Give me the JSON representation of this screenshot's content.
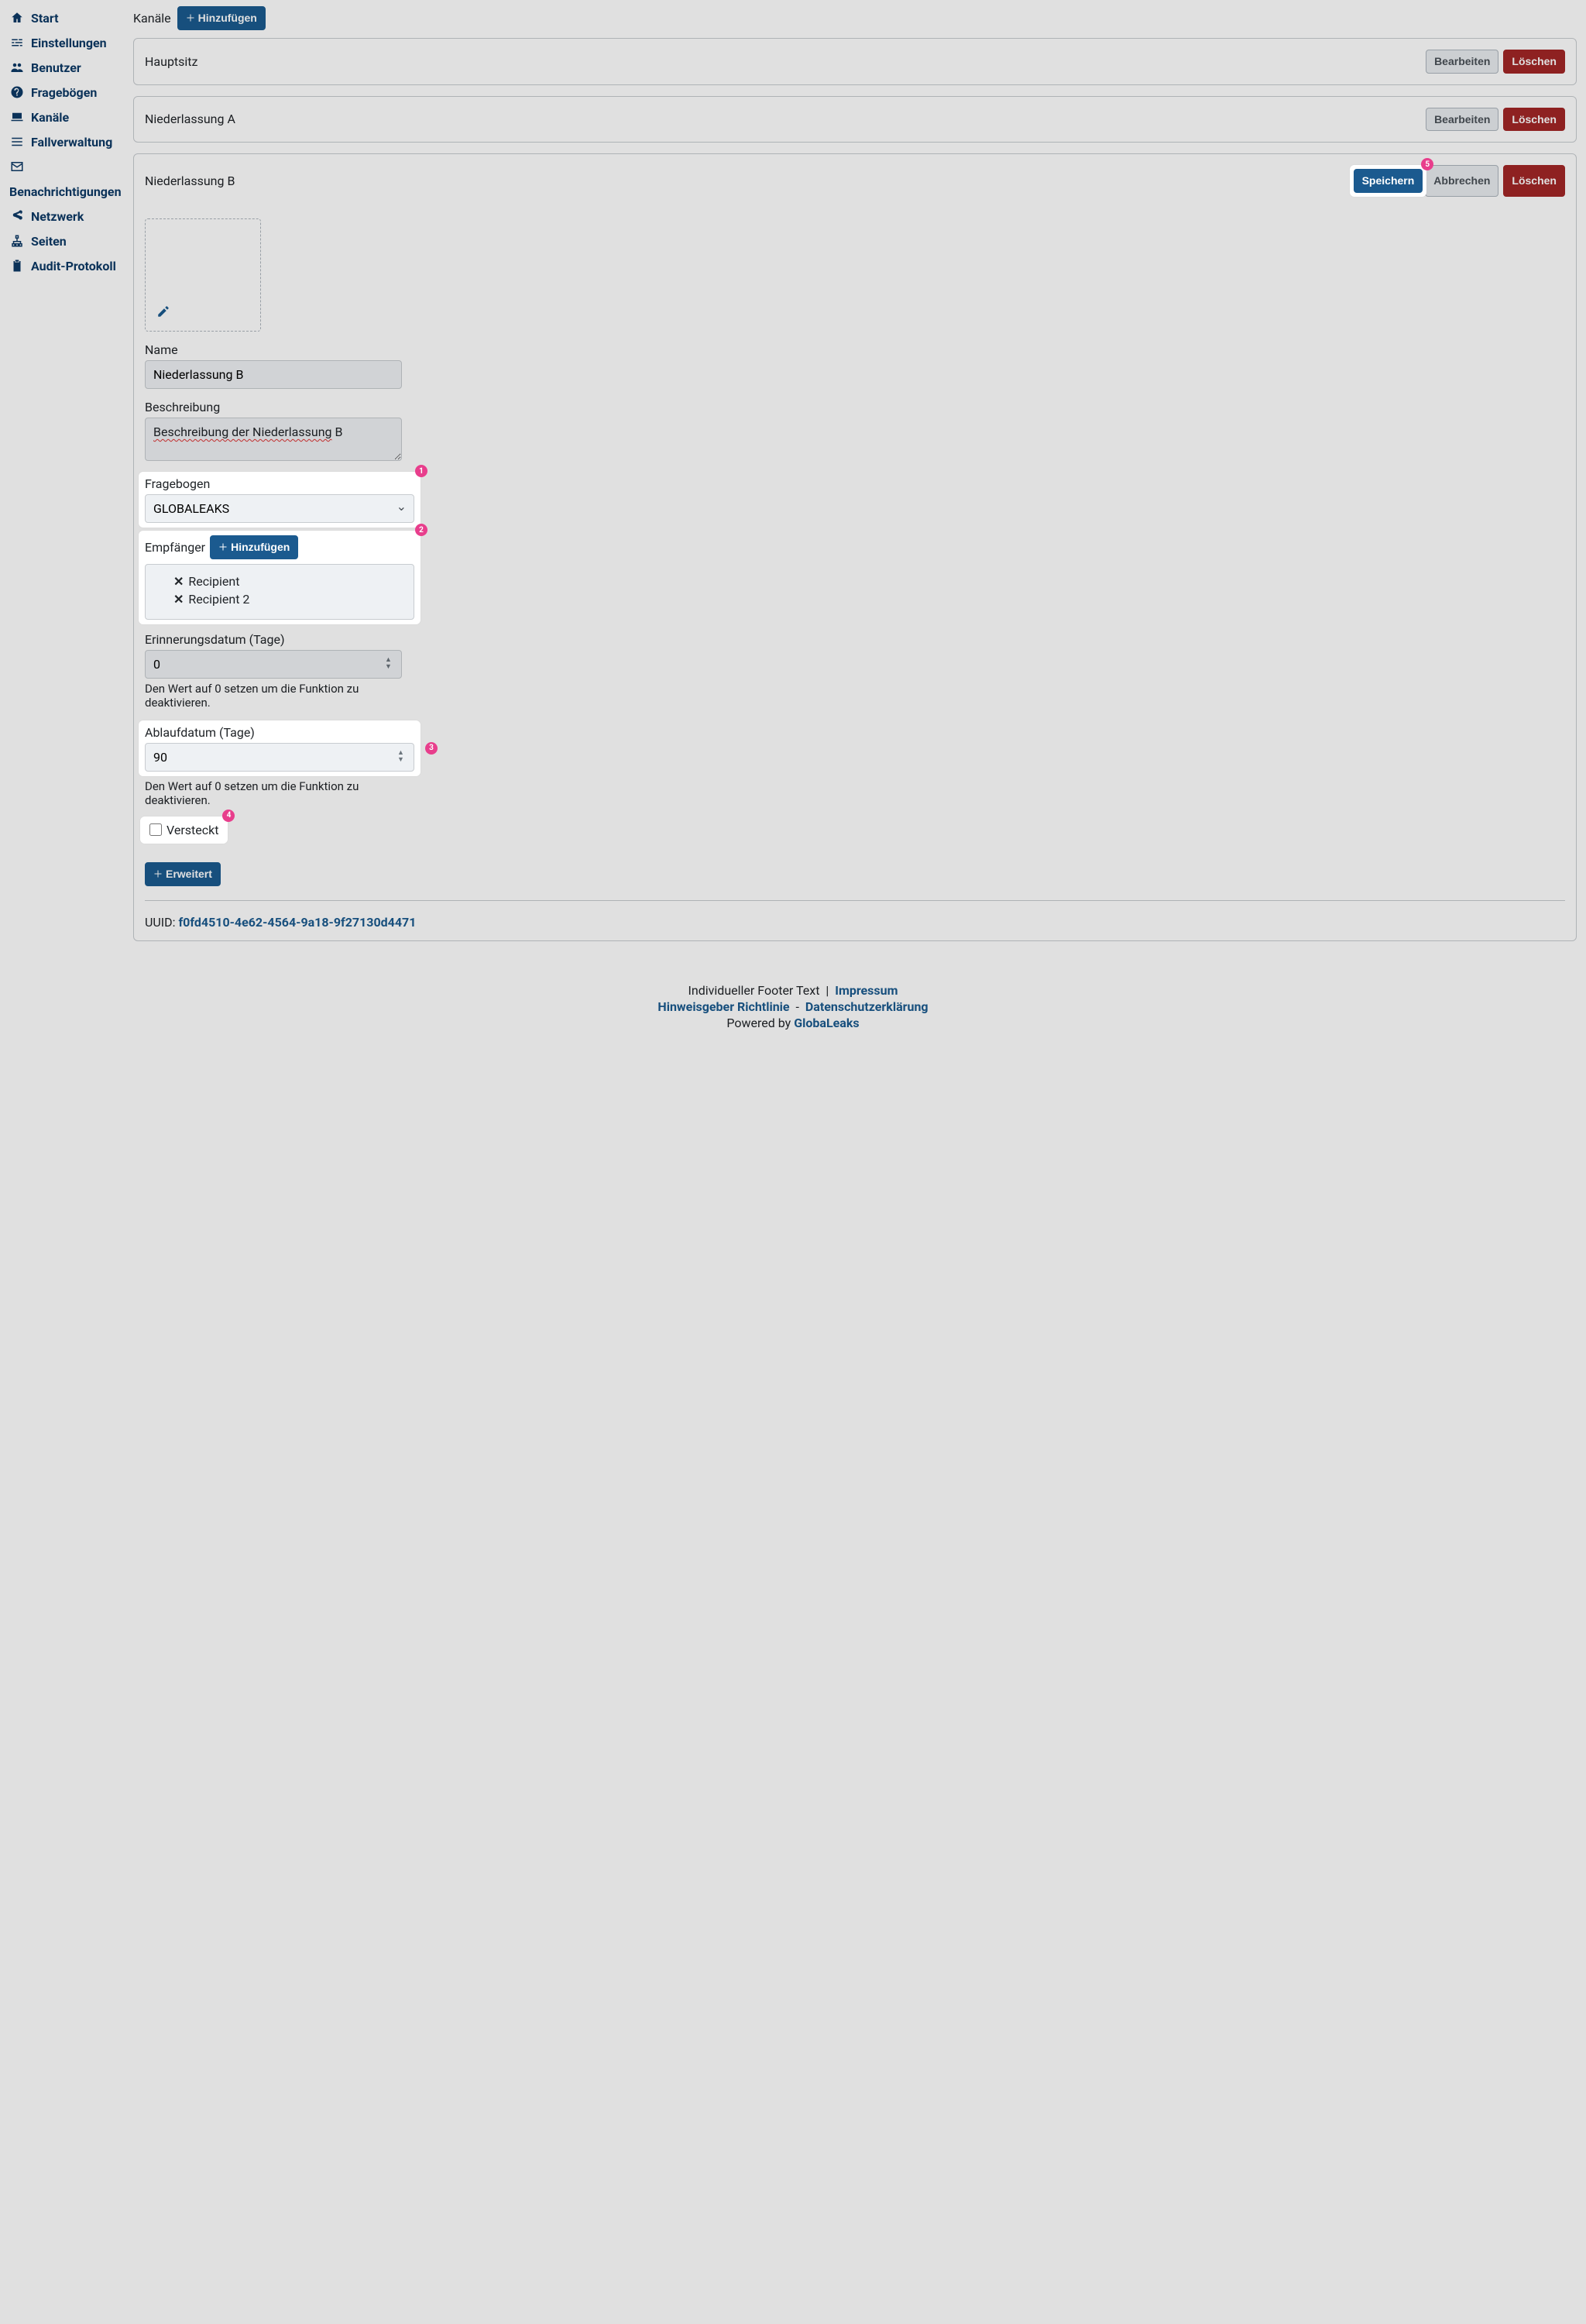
{
  "sidebar": {
    "items": [
      {
        "label": "Start",
        "icon": "home"
      },
      {
        "label": "Einstellungen",
        "icon": "sliders"
      },
      {
        "label": "Benutzer",
        "icon": "users"
      },
      {
        "label": "Fragebögen",
        "icon": "question"
      },
      {
        "label": "Kanäle",
        "icon": "laptop"
      },
      {
        "label": "Fallverwaltung",
        "icon": "list"
      },
      {
        "label": "Benachrichtigungen",
        "icon": "envelope"
      },
      {
        "label": "Netzwerk",
        "icon": "share"
      },
      {
        "label": "Seiten",
        "icon": "sitemap"
      },
      {
        "label": "Audit-Protokoll",
        "icon": "clipboard"
      }
    ]
  },
  "page": {
    "title": "Kanäle",
    "add_label": "Hinzufügen"
  },
  "channels": [
    {
      "title": "Hauptsitz",
      "edit": "Bearbeiten",
      "del": "Löschen"
    },
    {
      "title": "Niederlassung A",
      "edit": "Bearbeiten",
      "del": "Löschen"
    }
  ],
  "editing": {
    "title": "Niederlassung B",
    "save": "Speichern",
    "cancel": "Abbrechen",
    "del": "Löschen",
    "name_label": "Name",
    "name_value": "Niederlassung B",
    "desc_label": "Beschreibung",
    "desc_value_plain": "Beschreibung der Niederlassung",
    "desc_value_tail": " B",
    "questionnaire_label": "Fragebogen",
    "questionnaire_value": "GLOBALEAKS",
    "recipients_label": "Empfänger",
    "recipients_add": "Hinzufügen",
    "recipients": [
      "Recipient",
      "Recipient 2"
    ],
    "reminder_label": "Erinnerungsdatum (Tage)",
    "reminder_value": "0",
    "zero_hint": "Den Wert auf 0 setzen um die Funktion zu deaktivieren.",
    "expiry_label": "Ablaufdatum (Tage)",
    "expiry_value": "90",
    "hidden_label": "Versteckt",
    "advanced_label": "Erweitert",
    "uuid_label": "UUID: ",
    "uuid_value": "f0fd4510-4e62-4564-9a18-9f27130d4471"
  },
  "badges": {
    "b1": "1",
    "b2": "2",
    "b3": "3",
    "b4": "4",
    "b5": "5"
  },
  "footer": {
    "custom": "Individueller Footer Text",
    "impressum": "Impressum",
    "policy": "Hinweisgeber Richtlinie",
    "privacy": "Datenschutzerklärung",
    "powered": "Powered by ",
    "brand": "GlobaLeaks"
  }
}
